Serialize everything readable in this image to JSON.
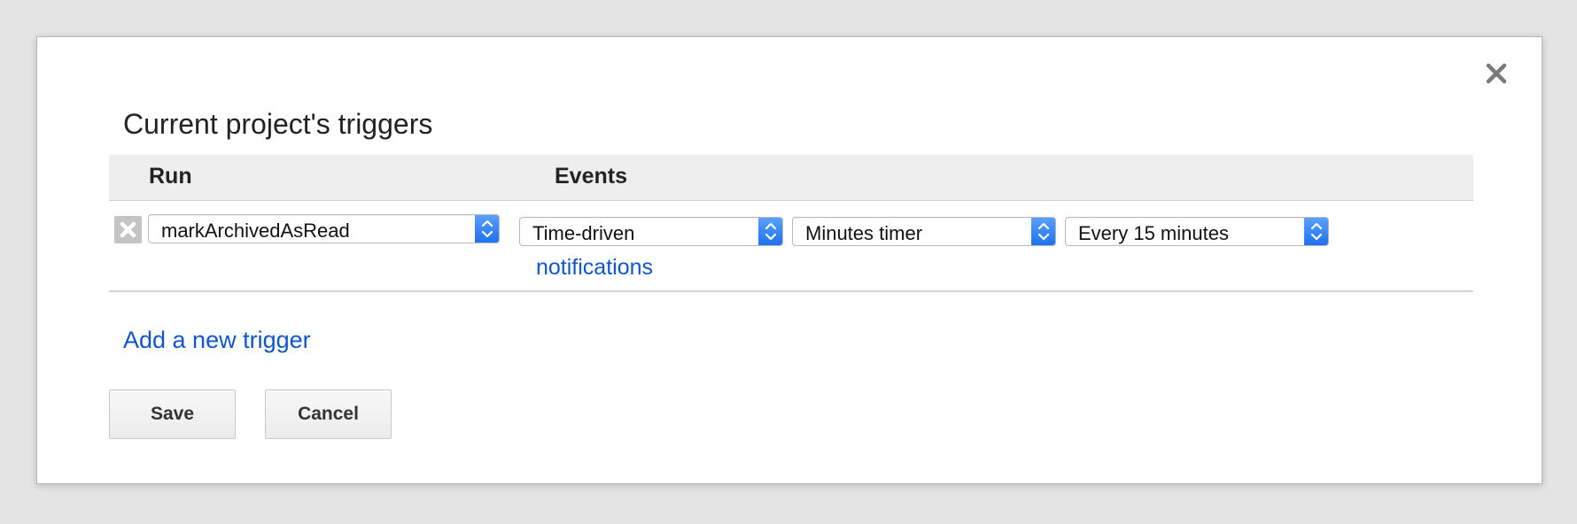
{
  "dialog": {
    "title": "Current project's triggers",
    "close_icon": "close-icon"
  },
  "table": {
    "headers": {
      "run": "Run",
      "events": "Events"
    },
    "rows": [
      {
        "delete_icon": "delete-x-icon",
        "function": "markArchivedAsRead",
        "event_source": "Time-driven",
        "timer_type": "Minutes timer",
        "interval": "Every 15 minutes",
        "notifications_label": "notifications"
      }
    ]
  },
  "actions": {
    "add_trigger_label": "Add a new trigger",
    "save_label": "Save",
    "cancel_label": "Cancel"
  },
  "colors": {
    "link": "#1155cc",
    "select_arrow": "#1f6ff0",
    "header_bg": "#eeeeee"
  }
}
